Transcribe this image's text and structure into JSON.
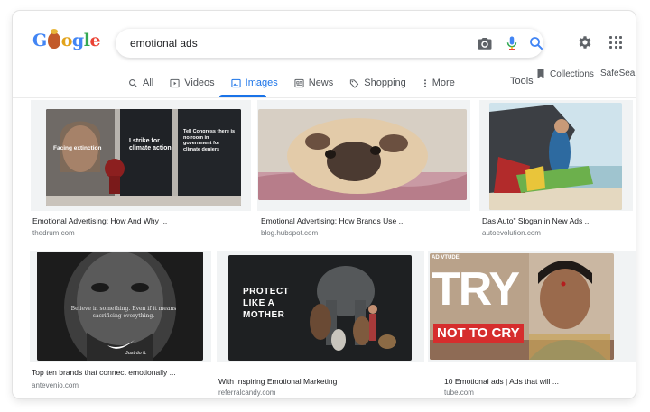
{
  "header": {
    "logo": "Google",
    "search_value": "emotional ads",
    "icons": [
      "camera-icon",
      "microphone-icon",
      "search-icon",
      "gear-icon",
      "apps-grid-icon"
    ]
  },
  "tabs": [
    {
      "label": "All",
      "icon": "search-icon",
      "active": false
    },
    {
      "label": "Videos",
      "icon": "play-icon",
      "active": false
    },
    {
      "label": "Images",
      "icon": "image-icon",
      "active": true
    },
    {
      "label": "News",
      "icon": "news-icon",
      "active": false
    },
    {
      "label": "Shopping",
      "icon": "tag-icon",
      "active": false
    },
    {
      "label": "More",
      "icon": "dots-icon",
      "active": false
    }
  ],
  "toolbar": {
    "tools": "Tools",
    "collections": "Collections",
    "safesearch": "SafeSear"
  },
  "results": [
    {
      "caption": "Emotional Advertising: How And Why ...",
      "source": "thedrum.com",
      "overlay": {
        "left": "Facing extinction",
        "mid": "I strike for climate action",
        "right": "Tell Congress there is no room in government for climate deniers"
      }
    },
    {
      "caption": "Emotional Advertising: How Brands Use ...",
      "source": "blog.hubspot.com"
    },
    {
      "caption": "Das Auto\" Slogan in New Ads ...",
      "source": "autoevolution.com"
    },
    {
      "caption": "Top ten brands that connect emotionally ...",
      "source": "antevenio.com",
      "overlay": {
        "quote": "Believe in something. Even if it means sacrificing everything.",
        "tag": "Just do it."
      }
    },
    {
      "caption": "With Inspiring Emotional Marketing",
      "source": "referralcandy.com",
      "overlay": {
        "headline": "PROTECT LIKE A MOTHER"
      }
    },
    {
      "caption": "10 Emotional ads | Ads that will ...",
      "source": "tube.com",
      "overlay": {
        "big": "TRY",
        "sub": "NOT TO CRY",
        "corner": "AD VTUDE"
      }
    }
  ]
}
